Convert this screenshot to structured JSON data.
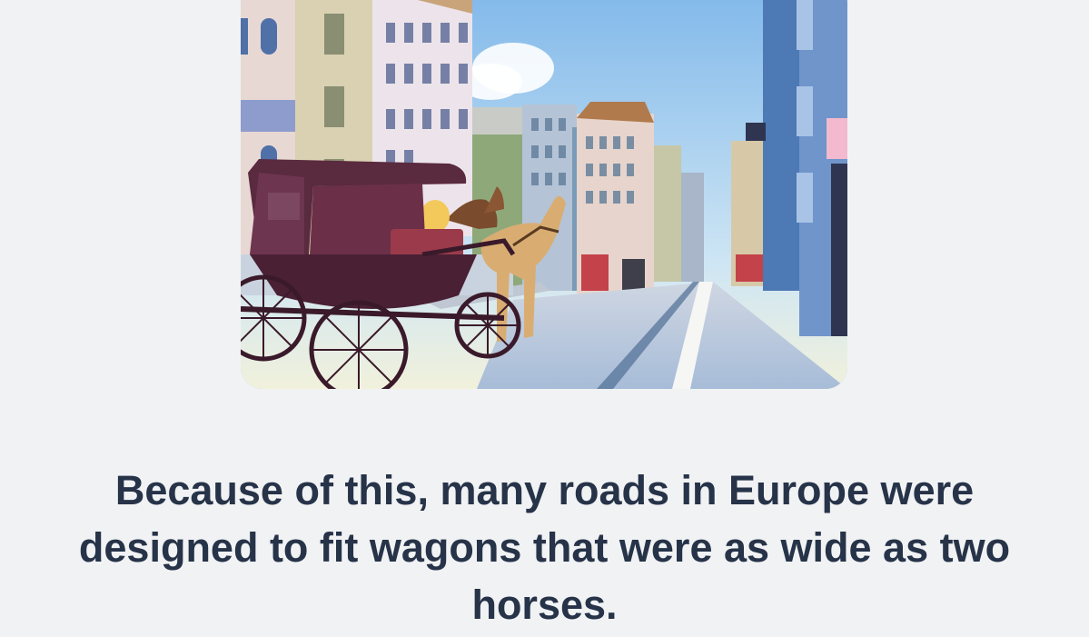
{
  "lesson": {
    "illustration": {
      "icon": "horse-carriage-street-illustration"
    },
    "caption": "Because of this, many roads in Europe were designed to fit wagons that were as wide as two horses."
  },
  "colors": {
    "background": "#f1f2f4",
    "caption_text": "#263348",
    "sky": "#8fc3ea",
    "carriage": "#5a2a3f",
    "horse": "#d9ad72",
    "road": "#b9c9de"
  }
}
